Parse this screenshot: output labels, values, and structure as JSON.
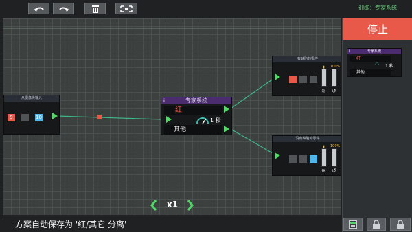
{
  "toolbar": {
    "undo_icon": "undo-arrow-icon",
    "redo_icon": "redo-arrow-icon",
    "delete_icon": "trash-icon",
    "fit_icon": "fit-view-icon"
  },
  "training_label": "训练：专家系统",
  "right_panel": {
    "stop_label": "停止",
    "mini_node": {
      "title": "专家系统",
      "info_icon": "i",
      "row1_label": "红",
      "row2_label": "其他",
      "timer": "1 秒"
    },
    "action_buttons": [
      "save-icon",
      "lock-icon",
      "lock-icon"
    ]
  },
  "nodes": {
    "camera": {
      "title": "从摄像头输入",
      "cells": [
        {
          "value": "9",
          "color": "#e8594a"
        },
        {
          "value": "",
          "color": "#505457"
        },
        {
          "value": "10",
          "color": "#4fb6e8"
        }
      ]
    },
    "expert": {
      "title": "专家系统",
      "info_icon": "i",
      "row1_label": "红",
      "row2_label": "其他",
      "timer": "1 秒"
    },
    "red_out": {
      "title": "有缺陷的零件",
      "percent": "100%",
      "level": 1.0,
      "cells": [
        "#e8594a",
        "#505457",
        "#505457"
      ]
    },
    "other_out": {
      "title": "没有缺陷的零件",
      "percent": "100%",
      "level": 1.0,
      "cells": [
        "#505457",
        "#505457",
        "#4fb6e8"
      ]
    }
  },
  "zoom": {
    "label": "x1",
    "left_icon": "chevron-left-icon",
    "right_icon": "chevron-right-icon"
  },
  "status_text": "方案自动保存为 '红/其它 分离'",
  "colors": {
    "accent_stop": "#e8594a",
    "port_green": "#4fd866",
    "title_purple": "#4b2c6f"
  }
}
